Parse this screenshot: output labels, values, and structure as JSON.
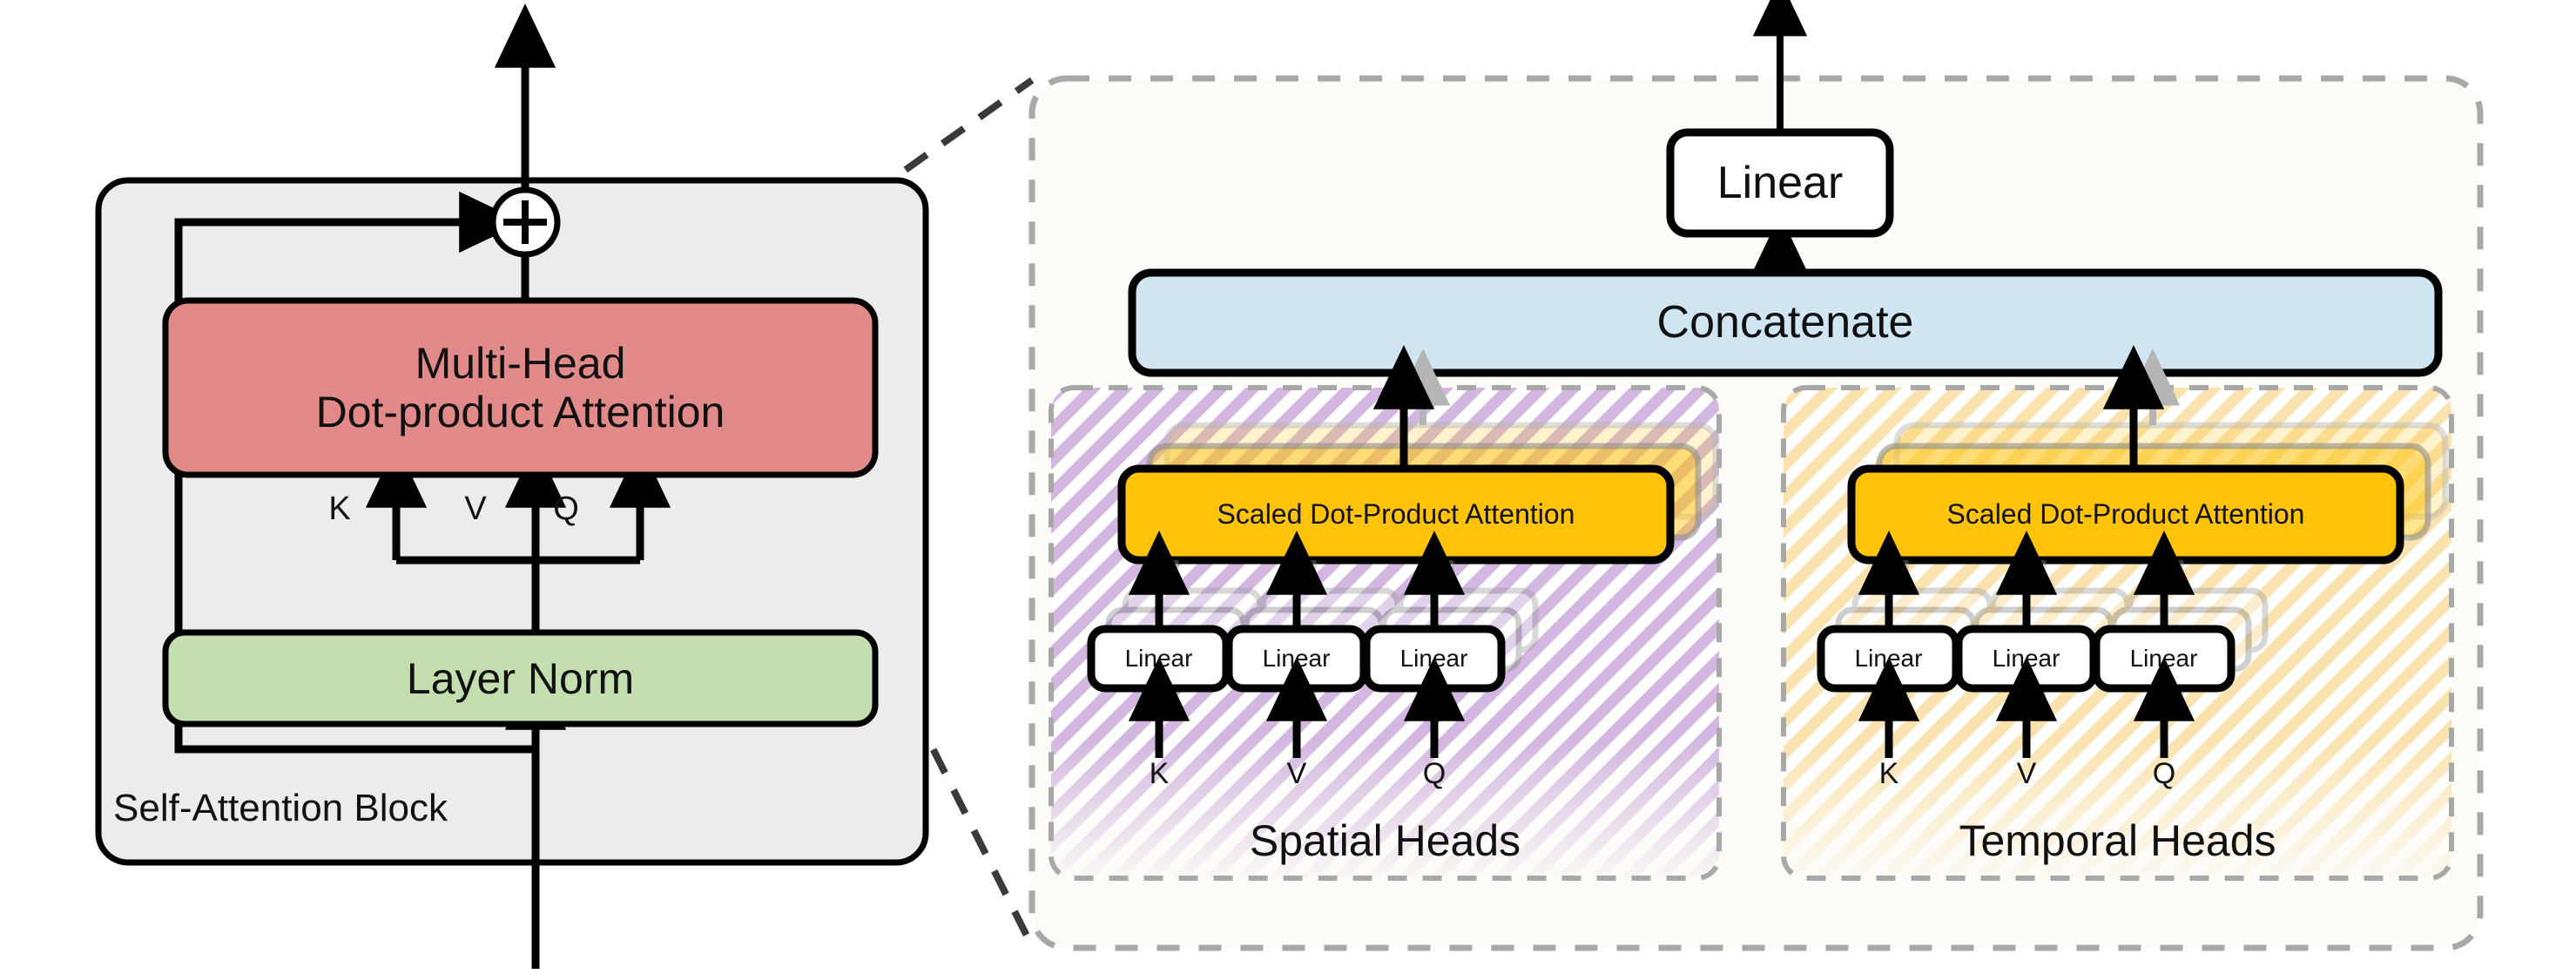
{
  "diagram": {
    "title": "Self-Attention Block with Spatial and Temporal Multi-Head Attention",
    "colors": {
      "block_fill": "#ececec",
      "attention_fill": "#e28a8a",
      "layernorm_fill": "#c3dfb0",
      "concatenate_fill": "#cfe5f2",
      "sdpa_fill": "#ffc40a",
      "spatial_hatch": "#d3b7e0",
      "temporal_hatch": "#fbe3b0",
      "panel_bg": "#fcfbf7",
      "dash_gray": "#a8a8a8",
      "stroke": "#000000",
      "ghost": "#b5b5b5"
    }
  },
  "left_block": {
    "label": "Self-Attention Block",
    "add_node": "+",
    "attention_box": {
      "line1": "Multi-Head",
      "line2": "Dot-product Attention"
    },
    "layernorm_box": "Layer Norm",
    "input_labels": [
      "K",
      "V",
      "Q"
    ]
  },
  "right_panel": {
    "linear_box": "Linear",
    "concatenate_box": "Concatenate",
    "heads": [
      {
        "name": "spatial",
        "caption": "Spatial Heads",
        "sdpa_label": "Scaled Dot-Product Attention",
        "linear_boxes": [
          "Linear",
          "Linear",
          "Linear"
        ],
        "input_labels": [
          "K",
          "V",
          "Q"
        ],
        "hatch_color": "#d3b7e0",
        "stack_depth": 3
      },
      {
        "name": "temporal",
        "caption": "Temporal Heads",
        "sdpa_label": "Scaled Dot-Product Attention",
        "linear_boxes": [
          "Linear",
          "Linear",
          "Linear"
        ],
        "input_labels": [
          "K",
          "V",
          "Q"
        ],
        "hatch_color": "#fbe3b0",
        "stack_depth": 3
      }
    ]
  }
}
